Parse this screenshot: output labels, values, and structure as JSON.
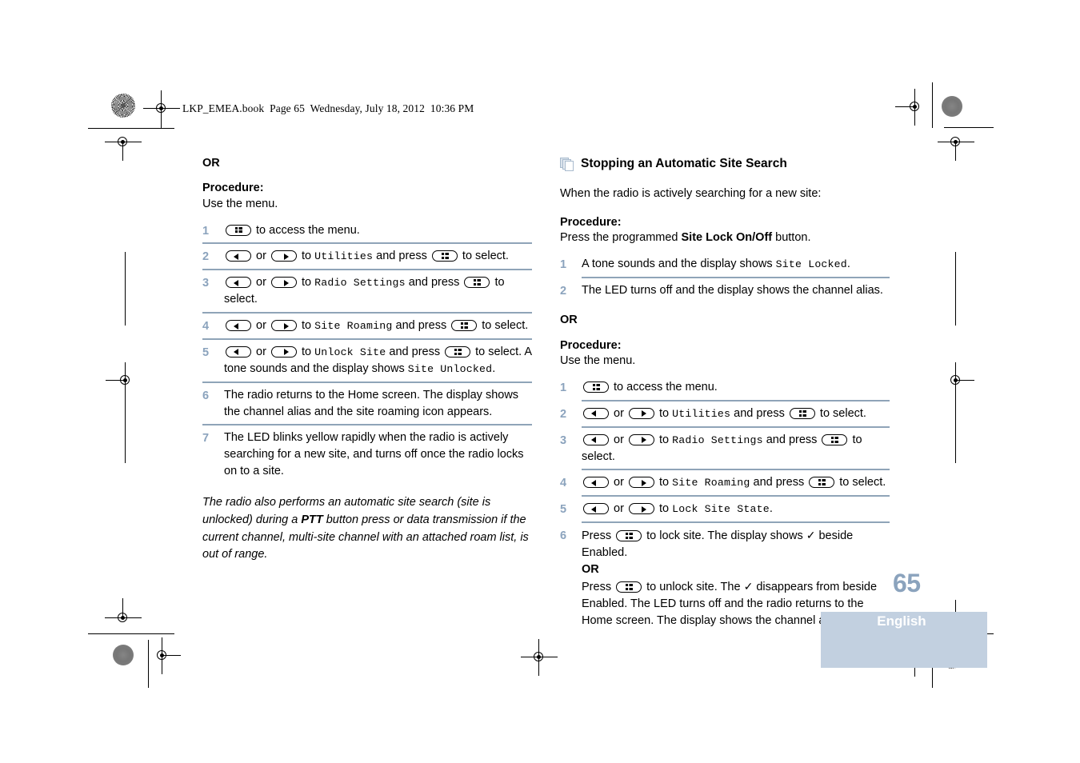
{
  "header": {
    "book_line": "LKP_EMEA.book  Page 65  Wednesday, July 18, 2012  10:36 PM"
  },
  "left_column": {
    "or_label": "OR",
    "procedure_label": "Procedure:",
    "procedure_intro": "Use the menu.",
    "steps": [
      {
        "num": "1",
        "parts": [
          {
            "type": "key",
            "icon": "menu-key-icon"
          },
          {
            "type": "text",
            "text": " to access the menu."
          }
        ]
      },
      {
        "num": "2",
        "parts": [
          {
            "type": "key",
            "icon": "left-arrow-key-icon"
          },
          {
            "type": "text",
            "text": " or "
          },
          {
            "type": "key",
            "icon": "right-arrow-key-icon"
          },
          {
            "type": "text",
            "text": " to "
          },
          {
            "type": "disp",
            "text": "Utilities"
          },
          {
            "type": "text",
            "text": " and press "
          },
          {
            "type": "key",
            "icon": "menu-key-icon"
          },
          {
            "type": "text",
            "text": " to select."
          }
        ]
      },
      {
        "num": "3",
        "parts": [
          {
            "type": "key",
            "icon": "left-arrow-key-icon"
          },
          {
            "type": "text",
            "text": " or "
          },
          {
            "type": "key",
            "icon": "right-arrow-key-icon"
          },
          {
            "type": "text",
            "text": " to "
          },
          {
            "type": "disp",
            "text": "Radio Settings"
          },
          {
            "type": "text",
            "text": " and press "
          },
          {
            "type": "key",
            "icon": "menu-key-icon"
          },
          {
            "type": "text",
            "text": " to select."
          }
        ]
      },
      {
        "num": "4",
        "parts": [
          {
            "type": "key",
            "icon": "left-arrow-key-icon"
          },
          {
            "type": "text",
            "text": " or "
          },
          {
            "type": "key",
            "icon": "right-arrow-key-icon"
          },
          {
            "type": "text",
            "text": " to "
          },
          {
            "type": "disp",
            "text": "Site Roaming"
          },
          {
            "type": "text",
            "text": " and press "
          },
          {
            "type": "key",
            "icon": "menu-key-icon"
          },
          {
            "type": "text",
            "text": " to select."
          }
        ]
      },
      {
        "num": "5",
        "parts": [
          {
            "type": "key",
            "icon": "left-arrow-key-icon"
          },
          {
            "type": "text",
            "text": " or "
          },
          {
            "type": "key",
            "icon": "right-arrow-key-icon"
          },
          {
            "type": "text",
            "text": " to "
          },
          {
            "type": "disp",
            "text": "Unlock Site"
          },
          {
            "type": "text",
            "text": " and press "
          },
          {
            "type": "key",
            "icon": "menu-key-icon"
          },
          {
            "type": "text",
            "text": " to select. A tone sounds and the display shows "
          },
          {
            "type": "disp",
            "text": "Site Unlocked"
          },
          {
            "type": "text",
            "text": "."
          }
        ]
      },
      {
        "num": "6",
        "parts": [
          {
            "type": "text",
            "text": "The radio returns to the Home screen. The display shows the channel alias and the site roaming icon appears."
          }
        ]
      },
      {
        "num": "7",
        "parts": [
          {
            "type": "text",
            "text": "The LED blinks yellow rapidly when the radio is actively searching for a new site, and turns off once the radio locks on to a site."
          }
        ]
      }
    ],
    "note": {
      "before": "The radio also performs an automatic site search (site is unlocked) during a ",
      "bold": "PTT",
      "after": " button press or data transmission if the current channel, multi-site channel with an attached roam list, is out of range."
    }
  },
  "right_column": {
    "section_icon": "stacked-pages-icon",
    "section_title": "Stopping an Automatic Site Search",
    "intro": "When the radio is actively searching for a new site:",
    "procedure_label_1": "Procedure:",
    "procedure_press": {
      "before": "Press the programmed ",
      "bold": "Site Lock On/Off",
      "after": " button."
    },
    "steps_1": [
      {
        "num": "1",
        "parts": [
          {
            "type": "text",
            "text": "A tone sounds and the display shows "
          },
          {
            "type": "disp",
            "text": "Site Locked"
          },
          {
            "type": "text",
            "text": "."
          }
        ]
      },
      {
        "num": "2",
        "parts": [
          {
            "type": "text",
            "text": "The LED turns off and the display shows the channel alias."
          }
        ]
      }
    ],
    "or_label": "OR",
    "procedure_label_2": "Procedure:",
    "procedure_intro_2": "Use the menu.",
    "steps_2": [
      {
        "num": "1",
        "parts": [
          {
            "type": "key",
            "icon": "menu-key-icon"
          },
          {
            "type": "text",
            "text": " to access the menu."
          }
        ]
      },
      {
        "num": "2",
        "parts": [
          {
            "type": "key",
            "icon": "left-arrow-key-icon"
          },
          {
            "type": "text",
            "text": " or "
          },
          {
            "type": "key",
            "icon": "right-arrow-key-icon"
          },
          {
            "type": "text",
            "text": " to "
          },
          {
            "type": "disp",
            "text": "Utilities"
          },
          {
            "type": "text",
            "text": " and press "
          },
          {
            "type": "key",
            "icon": "menu-key-icon"
          },
          {
            "type": "text",
            "text": " to select."
          }
        ]
      },
      {
        "num": "3",
        "parts": [
          {
            "type": "key",
            "icon": "left-arrow-key-icon"
          },
          {
            "type": "text",
            "text": " or "
          },
          {
            "type": "key",
            "icon": "right-arrow-key-icon"
          },
          {
            "type": "text",
            "text": " to "
          },
          {
            "type": "disp",
            "text": "Radio Settings"
          },
          {
            "type": "text",
            "text": " and press "
          },
          {
            "type": "key",
            "icon": "menu-key-icon"
          },
          {
            "type": "text",
            "text": " to select."
          }
        ]
      },
      {
        "num": "4",
        "parts": [
          {
            "type": "key",
            "icon": "left-arrow-key-icon"
          },
          {
            "type": "text",
            "text": " or "
          },
          {
            "type": "key",
            "icon": "right-arrow-key-icon"
          },
          {
            "type": "text",
            "text": " to "
          },
          {
            "type": "disp",
            "text": "Site Roaming"
          },
          {
            "type": "text",
            "text": " and press "
          },
          {
            "type": "key",
            "icon": "menu-key-icon"
          },
          {
            "type": "text",
            "text": " to select."
          }
        ]
      },
      {
        "num": "5",
        "parts": [
          {
            "type": "key",
            "icon": "left-arrow-key-icon"
          },
          {
            "type": "text",
            "text": " or "
          },
          {
            "type": "key",
            "icon": "right-arrow-key-icon"
          },
          {
            "type": "text",
            "text": " to "
          },
          {
            "type": "disp",
            "text": "Lock Site State"
          },
          {
            "type": "text",
            "text": "."
          }
        ]
      },
      {
        "num": "6",
        "parts": [
          {
            "type": "text",
            "text": "Press "
          },
          {
            "type": "key",
            "icon": "menu-key-icon"
          },
          {
            "type": "text",
            "text": " to lock site. The display shows "
          },
          {
            "type": "tick",
            "text": "✓"
          },
          {
            "type": "text",
            "text": " beside Enabled."
          },
          {
            "type": "or",
            "text": "OR"
          },
          {
            "type": "text",
            "text": "Press "
          },
          {
            "type": "key",
            "icon": "menu-key-icon"
          },
          {
            "type": "text",
            "text": " to unlock site. The "
          },
          {
            "type": "tick",
            "text": "✓"
          },
          {
            "type": "text",
            "text": " disappears from beside Enabled. The LED turns off and the radio returns to the Home screen. The display shows the channel alias."
          }
        ]
      }
    ]
  },
  "footer": {
    "page_number": "65",
    "language": "English"
  },
  "colors": {
    "accent_blue_gray": "#8ba3bd",
    "rule_blue_gray": "#8fa4b8",
    "language_band": "#c2d0e0"
  }
}
